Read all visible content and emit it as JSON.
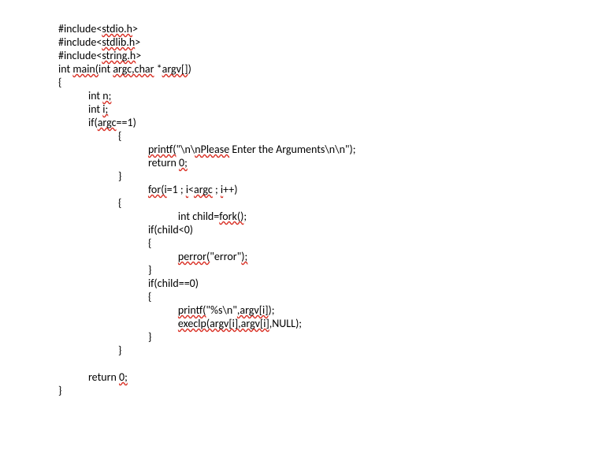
{
  "code": {
    "l1a": "#include<",
    "l1b": "stdio.h",
    "l1c": ">",
    "l2a": "#include<",
    "l2b": "stdlib.h",
    "l2c": ">",
    "l3a": "#include<",
    "l3b": "string.h",
    "l3c": ">",
    "l4a": "int",
    "l4b": " ",
    "l4c": "main(",
    "l4d": "int",
    "l4e": " ",
    "l4f": "argc,char",
    "l4g": " *",
    "l4h": "argv[]",
    "l4i": ")",
    "l5": "{",
    "l6a": "            int",
    "l6b": " ",
    "l6c": "n;",
    "l7a": "            int",
    "l7b": " ",
    "l7c": "i;",
    "l8a": "            if(",
    "l8b": "argc",
    "l8c": "==1)",
    "l9": "                        {",
    "l10a": "                                    ",
    "l10b": "printf(",
    "l10c": "\"\\n\\",
    "l10d": "nPlease",
    "l10e": " Enter the Arguments\\n\\n\");",
    "l11a": "                                    return ",
    "l11b": "0;",
    "l12": "                        }",
    "l13a": "                                    ",
    "l13b": "for(i",
    "l13c": "=1 ; ",
    "l13d": "i",
    "l13e": "<",
    "l13f": "argc",
    "l13g": " ; ",
    "l13h": "i",
    "l13i": "++)",
    "l14": "                        {",
    "l15a": "                                                int",
    "l15b": " child=",
    "l15c": "fork()",
    "l15d": ";",
    "l16": "                                    if(child<0)",
    "l17": "                                    {",
    "l18a": "                                                ",
    "l18b": "perror(",
    "l18c": "\"error\"",
    "l18d": ");",
    "l19": "                                    }",
    "l20": "                                    if(child==0)",
    "l21": "                                    {",
    "l22a": "                                                ",
    "l22b": "printf(",
    "l22c": "\"%s\\n\"",
    "l22d": ",argv[i]",
    "l22e": ");",
    "l23a": "                                                ",
    "l23b": "execlp(argv[i],argv[i]",
    "l23c": ",NULL);",
    "l24": "                                    }",
    "l25": "                        }",
    "blank": " ",
    "l26a": "            return ",
    "l26b": "0;",
    "l27": "}"
  }
}
